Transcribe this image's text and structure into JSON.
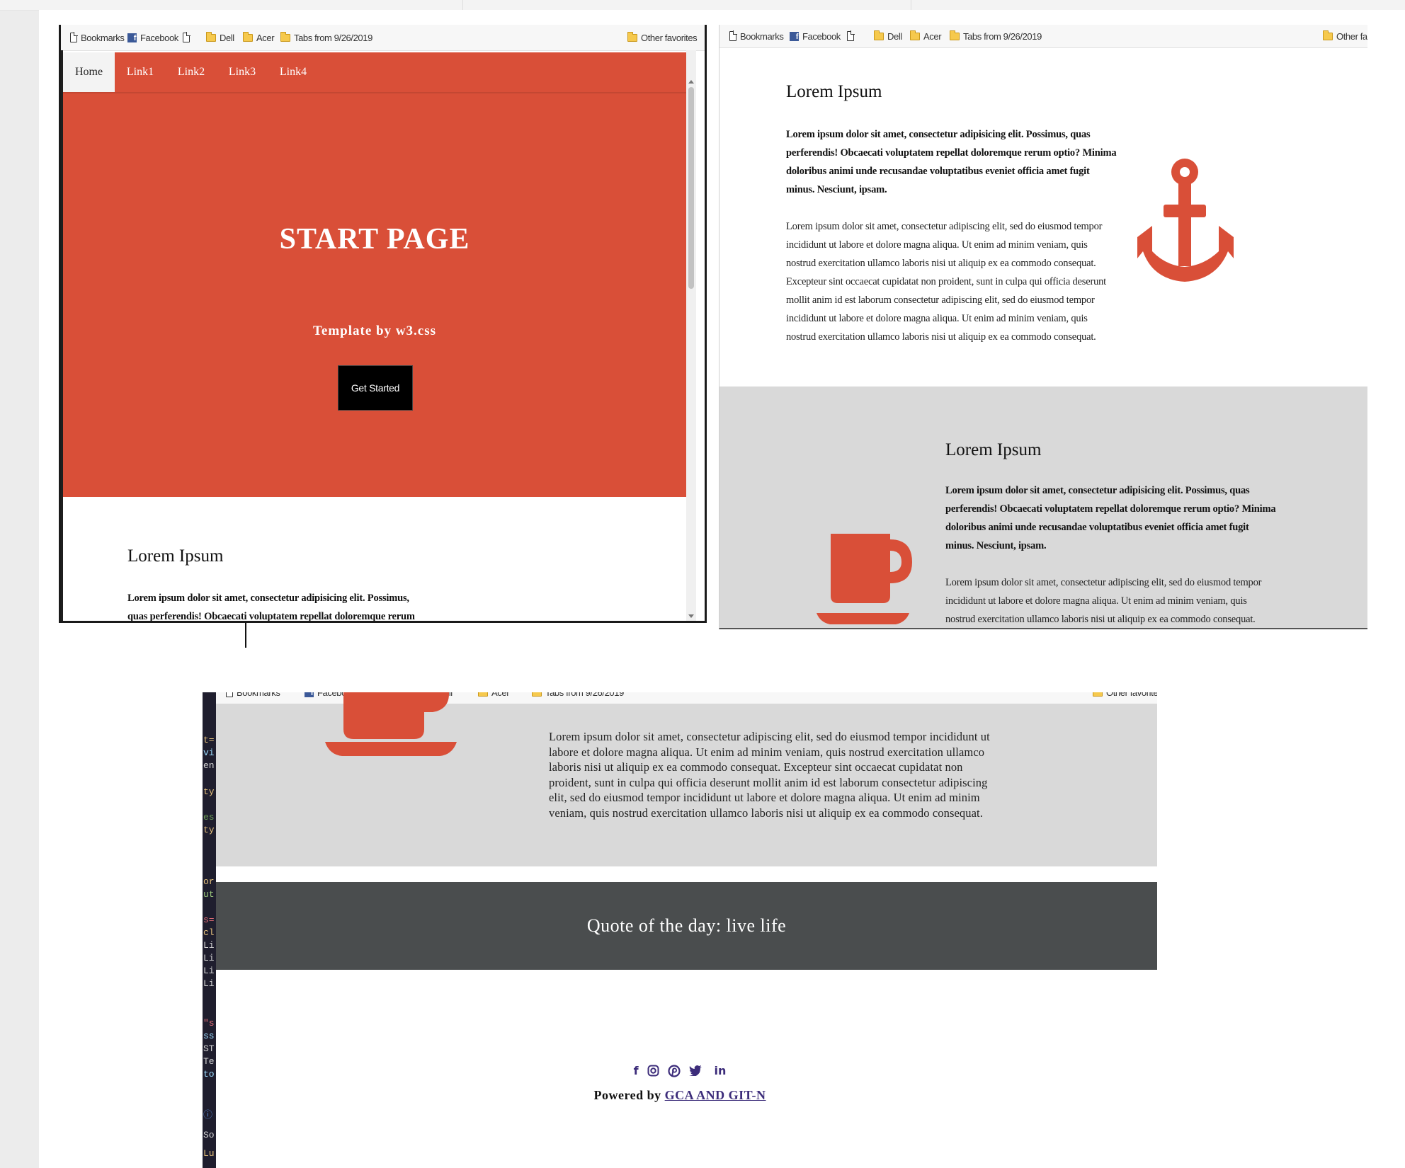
{
  "bookmarks_bar": {
    "items": [
      "Bookmarks",
      "Facebook",
      "",
      "Dell",
      "Acer",
      "Tabs from 9/26/2019"
    ],
    "other_favorites": "Other favorites",
    "other_favorites_cut": "Other fa"
  },
  "nav": {
    "items": [
      "Home",
      "Link1",
      "Link2",
      "Link3",
      "Link4"
    ],
    "active": "Home"
  },
  "hero": {
    "title": "START PAGE",
    "subtitle": "Template by w3.css",
    "button": "Get Started"
  },
  "section": {
    "heading": "Lorem Ipsum",
    "bold_paragraph": "Lorem ipsum dolor sit amet, consectetur adipisicing elit. Possimus, quas perferendis! Obcaecati voluptatem repellat doloremque rerum optio? Minima doloribus animi unde recusandae voluptatibus eveniet officia amet fugit minus. Nesciunt, ipsam.",
    "bold_paragraph_cut": "Lorem ipsum dolor sit amet, consectetur adipisicing elit. Possimus, quas perferendis! Obcaecati voluptatem repellat doloremque rerum optio?",
    "paragraph": "Lorem ipsum dolor sit amet, consectetur adipiscing elit, sed do eiusmod tempor incididunt ut labore et dolore magna aliqua. Ut enim ad minim veniam, quis nostrud exercitation ullamco laboris nisi ut aliquip ex ea commodo consequat. Excepteur sint occaecat cupidatat non proident, sunt in culpa qui officia deserunt mollit anim id est laborum consectetur adipiscing elit, sed do eiusmod tempor incididunt ut labore et dolore magna aliqua. Ut enim ad minim veniam, quis nostrud exercitation ullamco laboris nisi ut aliquip ex ea commodo consequat.",
    "paragraph_cut": "Lorem ipsum dolor sit amet, consectetur adipiscing elit, sed do eiusmod tempor incididunt ut labore et dolore magna aliqua. Ut enim ad minim veniam, quis nostrud exercitation ullamco laboris nisi ut aliquip ex ea commodo consequat."
  },
  "icons": {
    "anchor": "anchor-icon",
    "coffee": "coffee-icon"
  },
  "quote": "Quote of the day: live life",
  "footer": {
    "social_icons": [
      "facebook-icon",
      "instagram-icon",
      "pinterest-icon",
      "twitter-icon",
      "linkedin-icon"
    ],
    "powered_by": "Powered by",
    "link": "GCA AND GIT-N"
  },
  "colors": {
    "accent": "#d94f38",
    "grey_section": "#d9d9d9",
    "quote_bar": "#4a4d4e",
    "footer_link": "#3c2c7a"
  }
}
